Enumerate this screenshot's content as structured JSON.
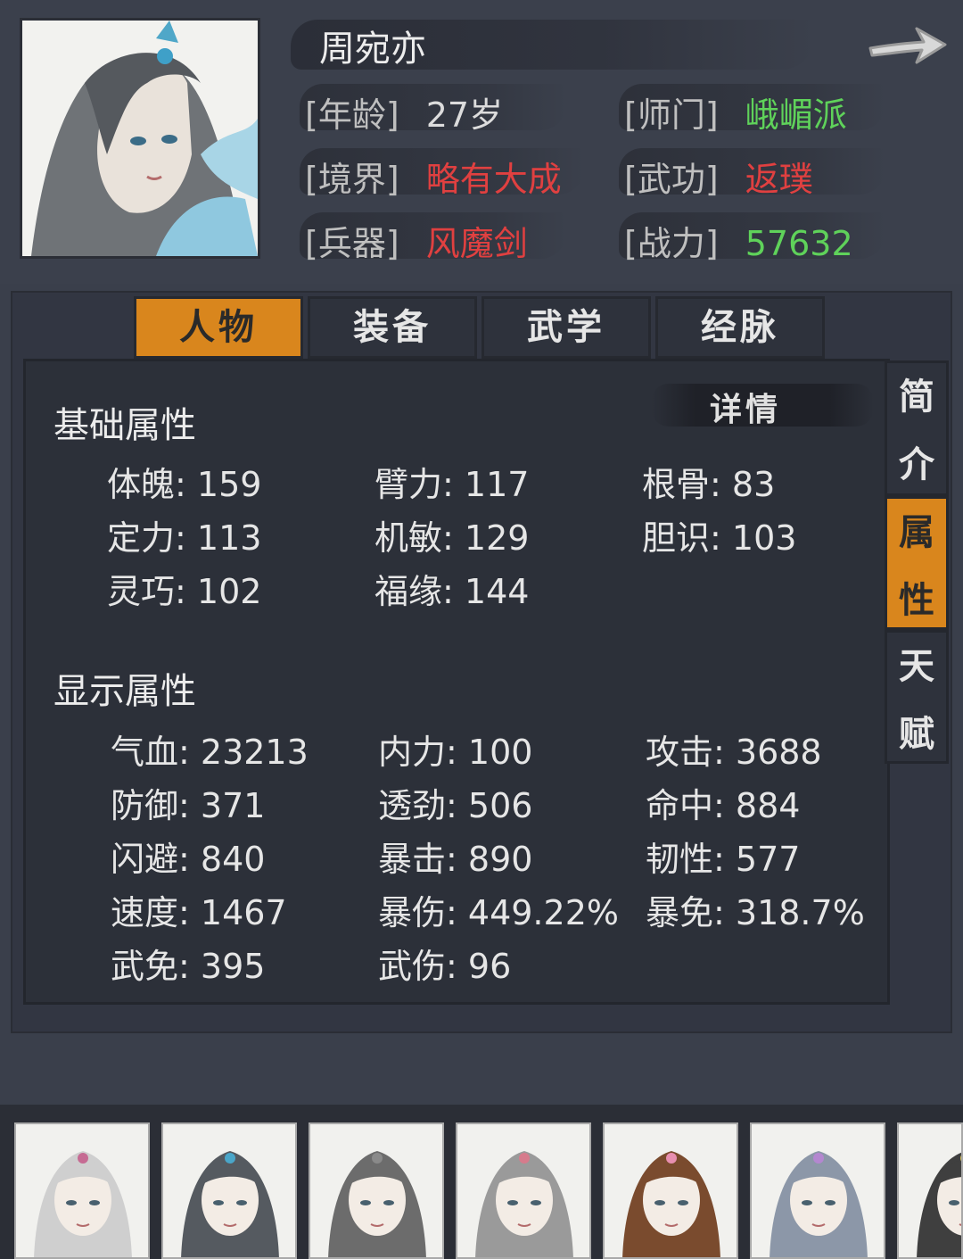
{
  "character": {
    "name": "周宛亦",
    "info": [
      {
        "label": "[年龄]",
        "value": "27岁",
        "color": "#dcdcdc"
      },
      {
        "label": "[师门]",
        "value": "峨嵋派",
        "color": "#5fd25a"
      },
      {
        "label": "[境界]",
        "value": "略有大成",
        "color": "#e04040"
      },
      {
        "label": "[武功]",
        "value": "返璞",
        "color": "#e04040"
      },
      {
        "label": "[兵器]",
        "value": "风魔剑",
        "color": "#e04040"
      },
      {
        "label": "[战力]",
        "value": "57632",
        "color": "#5fd25a"
      }
    ]
  },
  "tabs": [
    "人物",
    "装备",
    "武学",
    "经脉"
  ],
  "active_tab": "人物",
  "detail_label": "详情",
  "side_tabs": [
    {
      "label": "简介",
      "chars": [
        "简",
        "介"
      ]
    },
    {
      "label": "属性",
      "chars": [
        "属",
        "性"
      ],
      "active": true
    },
    {
      "label": "天赋",
      "chars": [
        "天",
        "赋"
      ]
    }
  ],
  "base_attributes": {
    "title": "基础属性",
    "items": [
      {
        "name": "体魄",
        "value": "159"
      },
      {
        "name": "臂力",
        "value": "117"
      },
      {
        "name": "根骨",
        "value": "83"
      },
      {
        "name": "定力",
        "value": "113"
      },
      {
        "name": "机敏",
        "value": "129"
      },
      {
        "name": "胆识",
        "value": "103"
      },
      {
        "name": "灵巧",
        "value": "102"
      },
      {
        "name": "福缘",
        "value": "144"
      }
    ]
  },
  "display_attributes": {
    "title": "显示属性",
    "items": [
      {
        "name": "气血",
        "value": "23213"
      },
      {
        "name": "内力",
        "value": "100"
      },
      {
        "name": "攻击",
        "value": "3688"
      },
      {
        "name": "防御",
        "value": "371"
      },
      {
        "name": "透劲",
        "value": "506"
      },
      {
        "name": "命中",
        "value": "884"
      },
      {
        "name": "闪避",
        "value": "840"
      },
      {
        "name": "暴击",
        "value": "890"
      },
      {
        "name": "韧性",
        "value": "577"
      },
      {
        "name": "速度",
        "value": "1467"
      },
      {
        "name": "暴伤",
        "value": "449.22%"
      },
      {
        "name": "暴免",
        "value": "318.7%"
      },
      {
        "name": "武免",
        "value": "395"
      },
      {
        "name": "武伤",
        "value": "96"
      }
    ]
  },
  "roster": [
    {
      "hair": "#cfcfcf",
      "accent": "#c66b93"
    },
    {
      "hair": "#555a60",
      "accent": "#4aa6c9"
    },
    {
      "hair": "#6c6c6c",
      "accent": "#8a8a8a"
    },
    {
      "hair": "#9a9a9a",
      "accent": "#d67b8c"
    },
    {
      "hair": "#7a4b2e",
      "accent": "#e88fb0"
    },
    {
      "hair": "#8c97a8",
      "accent": "#b487d0"
    },
    {
      "hair": "#3f3f3f",
      "accent": "#d8c25a"
    }
  ],
  "colors": {
    "accent_orange": "#d9861d",
    "value_green": "#5fd25a",
    "value_red": "#e04040"
  }
}
